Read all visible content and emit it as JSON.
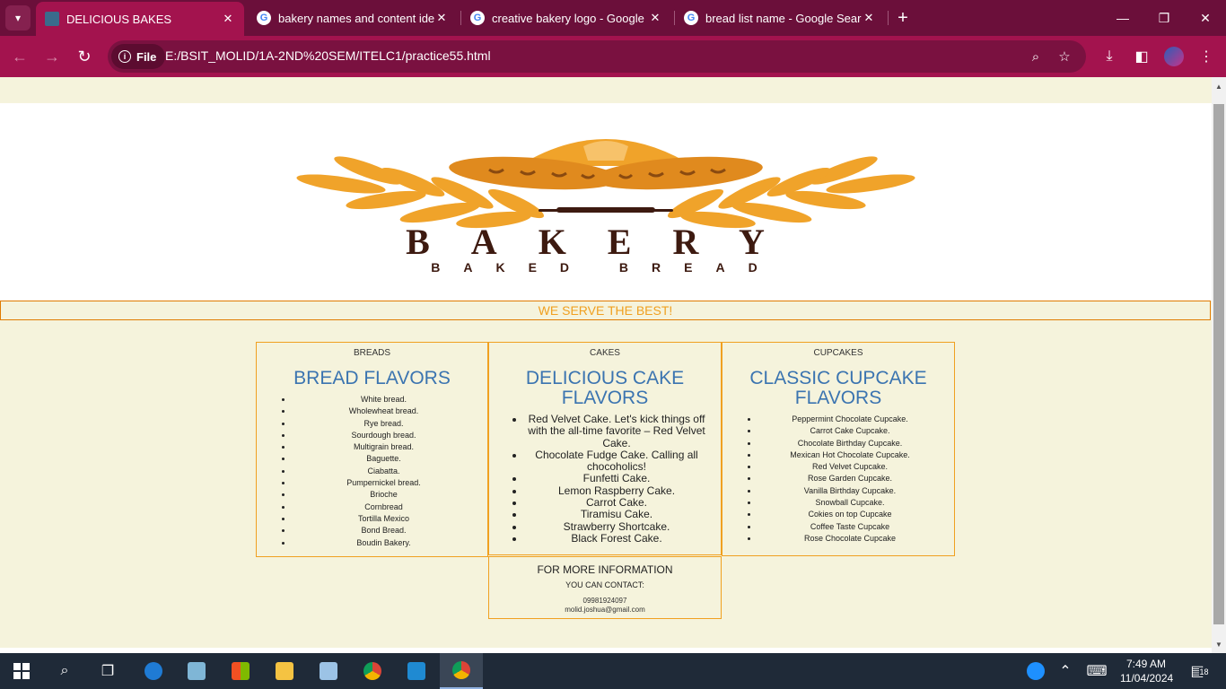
{
  "browser": {
    "tabs": [
      {
        "title": "DELICIOUS BAKES",
        "active": true
      },
      {
        "title": "bakery names and content ideas",
        "active": false
      },
      {
        "title": "creative bakery logo - Google Search",
        "active": false
      },
      {
        "title": "bread list name - Google Search",
        "active": false
      }
    ],
    "site_chip": "File",
    "url": "E:/BSIT_MOLID/1A-2ND%20SEM/ITELC1/practice55.html"
  },
  "logo": {
    "word": "BAKERY",
    "tagline": "BAKED BREAD",
    "colors": {
      "wheat": "#f0a32a",
      "brown": "#3d1a10"
    }
  },
  "page": {
    "serve": "WE SERVE THE BEST!",
    "breads": {
      "category": "BREADS",
      "heading": "BREAD FLAVORS",
      "items": [
        "White bread.",
        "Wholewheat bread.",
        "Rye bread.",
        "Sourdough bread.",
        "Multigrain bread.",
        "Baguette.",
        "Ciabatta.",
        "Pumpernickel bread.",
        "Brioche",
        "Cornbread",
        "Tortilla Mexico",
        "Bond Bread.",
        "Boudin Bakery."
      ]
    },
    "cakes": {
      "category": "CAKES",
      "heading": "DELICIOUS CAKE FLAVORS",
      "items": [
        "Red Velvet Cake. Let's kick things off with the all-time favorite – Red Velvet Cake.",
        "Chocolate Fudge Cake. Calling all chocoholics!",
        "Funfetti Cake.",
        "Lemon Raspberry Cake.",
        "Carrot Cake.",
        "Tiramisu Cake.",
        "Strawberry Shortcake.",
        "Black Forest Cake."
      ]
    },
    "cupcakes": {
      "category": "CUPCAKES",
      "heading": "CLASSIC CUPCAKE FLAVORS",
      "items": [
        "Peppermint Chocolate Cupcake.",
        "Carrot Cake Cupcake.",
        "Chocolate Birthday Cupcake.",
        "Mexican Hot Chocolate Cupcake.",
        "Red Velvet Cupcake.",
        "Rose Garden Cupcake.",
        "Vanilla Birthday Cupcake.",
        "Snowball Cupcake.",
        "Cokies on top Cupcake",
        "Coffee Taste Cupcake",
        "Rose Chocolate Cupcake"
      ]
    },
    "info": {
      "title": "FOR MORE INFORMATION",
      "contact": "YOU CAN CONTACT:",
      "phone": "09981924097",
      "email": "molid.joshua@gmail.com"
    }
  },
  "taskbar": {
    "time": "7:49 AM",
    "date": "11/04/2024",
    "notification_count": "18"
  }
}
